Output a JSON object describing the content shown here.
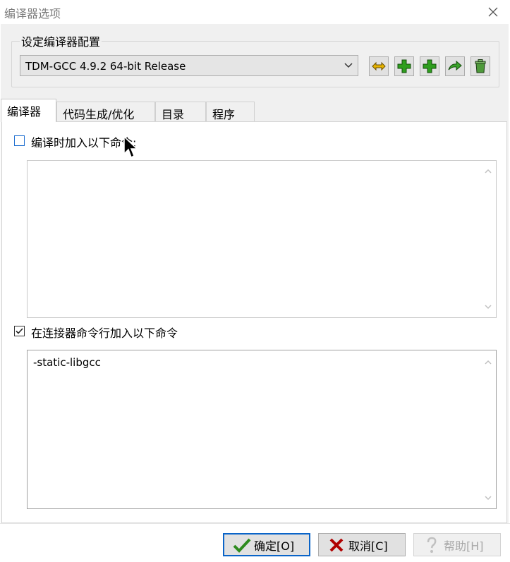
{
  "window": {
    "title": "编译器选项"
  },
  "config": {
    "group_label": "设定编译器配置",
    "selected_compiler": "TDM-GCC 4.9.2 64-bit Release",
    "toolbar_icons": [
      "rename-icon",
      "add-icon",
      "add-copy-icon",
      "export-icon",
      "delete-icon"
    ]
  },
  "tabs": [
    {
      "label": "编译器",
      "active": true
    },
    {
      "label": "代码生成/优化",
      "active": false
    },
    {
      "label": "目录",
      "active": false
    },
    {
      "label": "程序",
      "active": false
    }
  ],
  "compiler_page": {
    "compile_cmd": {
      "label": "编译时加入以下命令:",
      "checked": false,
      "value": ""
    },
    "linker_cmd": {
      "label": "在连接器命令行加入以下命令",
      "checked": true,
      "value": "-static-libgcc"
    }
  },
  "buttons": {
    "ok": "确定[O]",
    "cancel": "取消[C]",
    "help": "帮助[H]"
  },
  "colors": {
    "accent": "#0a64c8",
    "checkbox_focus": "#1f6fd0",
    "add_green": "#2e9e1e"
  }
}
